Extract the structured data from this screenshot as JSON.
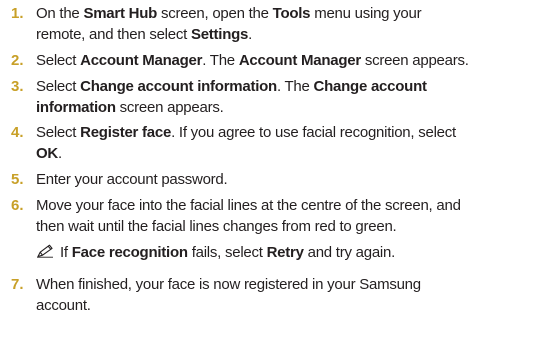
{
  "steps": [
    {
      "number": "1.",
      "lines": [
        [
          {
            "t": "On the ",
            "b": false
          },
          {
            "t": "Smart Hub",
            "b": true
          },
          {
            "t": " screen, open the ",
            "b": false
          },
          {
            "t": "Tools",
            "b": true
          },
          {
            "t": " menu using your",
            "b": false
          }
        ],
        [
          {
            "t": "remote, and then select ",
            "b": false
          },
          {
            "t": "Settings",
            "b": true
          },
          {
            "t": ".",
            "b": false
          }
        ]
      ]
    },
    {
      "number": "2.",
      "lines": [
        [
          {
            "t": "Select ",
            "b": false
          },
          {
            "t": "Account Manager",
            "b": true
          },
          {
            "t": ". The ",
            "b": false
          },
          {
            "t": "Account Manager",
            "b": true
          },
          {
            "t": " screen appears.",
            "b": false
          }
        ]
      ]
    },
    {
      "number": "3.",
      "lines": [
        [
          {
            "t": "Select ",
            "b": false
          },
          {
            "t": "Change account information",
            "b": true
          },
          {
            "t": ". The ",
            "b": false
          },
          {
            "t": "Change account",
            "b": true
          }
        ],
        [
          {
            "t": "information",
            "b": true
          },
          {
            "t": " screen appears.",
            "b": false
          }
        ]
      ]
    },
    {
      "number": "4.",
      "lines": [
        [
          {
            "t": "Select ",
            "b": false
          },
          {
            "t": "Register face",
            "b": true
          },
          {
            "t": ". If you agree to use facial recognition, select",
            "b": false
          }
        ],
        [
          {
            "t": "OK",
            "b": true
          },
          {
            "t": ".",
            "b": false
          }
        ]
      ]
    },
    {
      "number": "5.",
      "lines": [
        [
          {
            "t": "Enter your account password.",
            "b": false
          }
        ]
      ]
    },
    {
      "number": "6.",
      "lines": [
        [
          {
            "t": "Move your face into the facial lines at the centre of the screen, and",
            "b": false
          }
        ],
        [
          {
            "t": "then wait until the facial lines changes from red to green.",
            "b": false
          }
        ]
      ],
      "note": [
        {
          "t": "If ",
          "b": false
        },
        {
          "t": "Face recognition",
          "b": true
        },
        {
          "t": " fails, select ",
          "b": false
        },
        {
          "t": "Retry",
          "b": true
        },
        {
          "t": " and try again.",
          "b": false
        }
      ]
    },
    {
      "number": "7.",
      "lines": [
        [
          {
            "t": "When finished, your face is now registered in your Samsung",
            "b": false
          }
        ],
        [
          {
            "t": "account.",
            "b": false
          }
        ]
      ]
    }
  ],
  "note_icon": "pencil-note-icon",
  "colors": {
    "number": "#c8a028",
    "text": "#231f20"
  }
}
